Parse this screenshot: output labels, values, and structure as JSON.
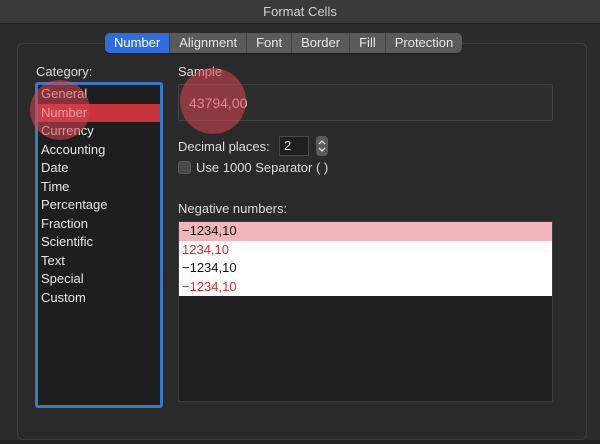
{
  "window": {
    "title": "Format Cells"
  },
  "tabs": [
    {
      "label": "Number",
      "active": true
    },
    {
      "label": "Alignment",
      "active": false
    },
    {
      "label": "Font",
      "active": false
    },
    {
      "label": "Border",
      "active": false
    },
    {
      "label": "Fill",
      "active": false
    },
    {
      "label": "Protection",
      "active": false
    }
  ],
  "category": {
    "label": "Category:",
    "items": [
      "General",
      "Number",
      "Currency",
      "Accounting",
      "Date",
      "Time",
      "Percentage",
      "Fraction",
      "Scientific",
      "Text",
      "Special",
      "Custom"
    ],
    "selected": "Number"
  },
  "sample": {
    "label": "Sample",
    "value": "43794,00"
  },
  "decimal_places": {
    "label": "Decimal places:",
    "value": "2"
  },
  "separator": {
    "label": "Use 1000 Separator ( )",
    "checked": false
  },
  "negative_numbers": {
    "label": "Negative numbers:",
    "items": [
      {
        "text": "−1234,10",
        "color": "black",
        "selected": true
      },
      {
        "text": "1234,10",
        "color": "red",
        "selected": false
      },
      {
        "text": "−1234,10",
        "color": "black",
        "selected": false
      },
      {
        "text": "−1234,10",
        "color": "red",
        "selected": false
      }
    ]
  },
  "colors": {
    "accent_tab": "#2f6ed8",
    "selection_red": "#c8343c",
    "list_border_blue": "#3a78c4",
    "negative_red": "#d42e2e"
  }
}
